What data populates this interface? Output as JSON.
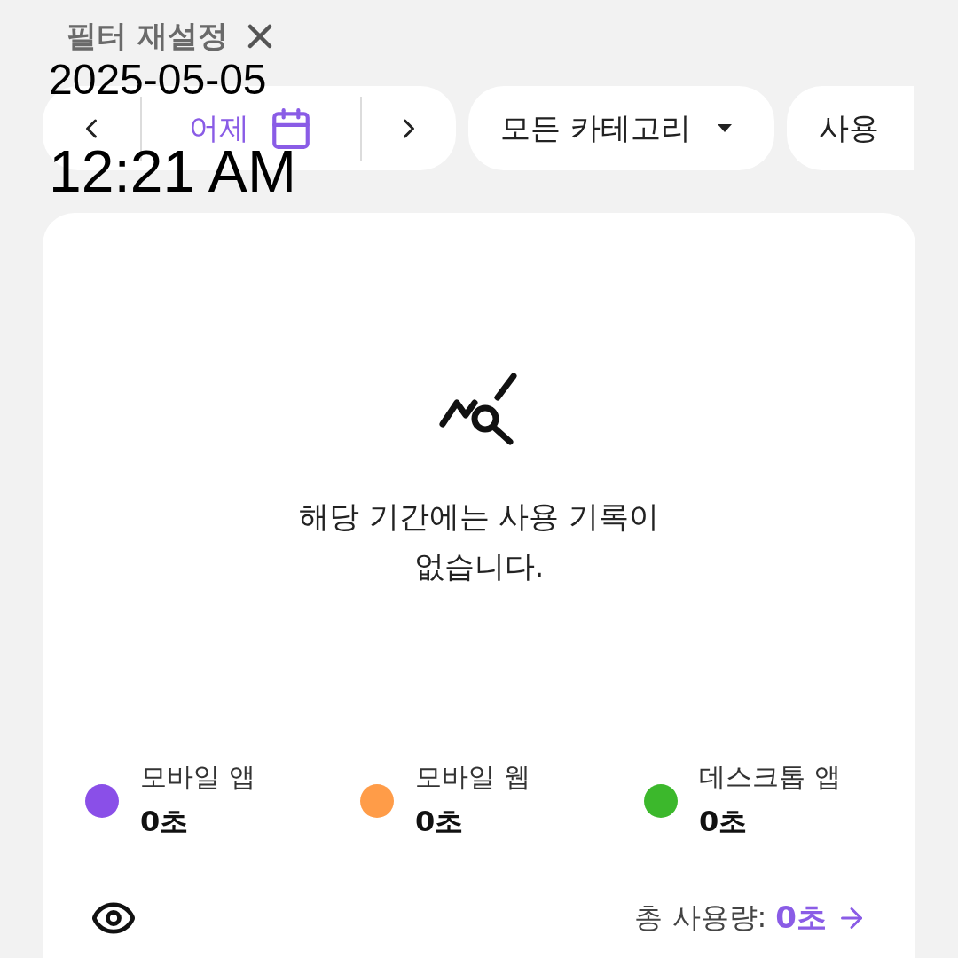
{
  "reset_filter": {
    "label": "필터 재설정"
  },
  "filter_bar": {
    "date_label": "어제",
    "category": "모든 카테고리",
    "chip_3": "사용"
  },
  "empty_state": {
    "message": "해당 기간에는 사용 기록이\n없습니다."
  },
  "legend": [
    {
      "label": "모바일 앱",
      "value": "0초",
      "color": "#8a4fe8"
    },
    {
      "label": "모바일 웹",
      "value": "0초",
      "color": "#ff9c48"
    },
    {
      "label": "데스크톱 앱",
      "value": "0초",
      "color": "#3cb82c"
    }
  ],
  "total": {
    "label": "총 사용량:",
    "value": "0초"
  },
  "timestamp": {
    "date": "2025-05-05",
    "time": "12:21 AM"
  }
}
